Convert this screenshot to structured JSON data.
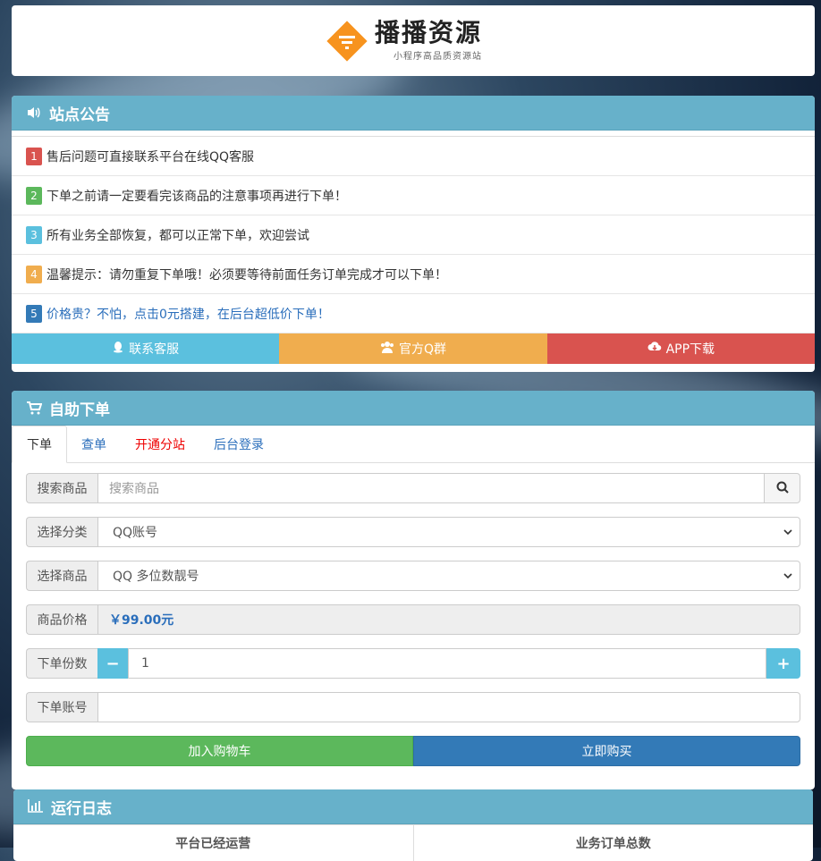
{
  "logo": {
    "title": "播播资源",
    "subtitle": "小程序高品质资源站",
    "accent": "#f7931e"
  },
  "notice": {
    "header": "站点公告",
    "items": [
      {
        "num": "1",
        "text": "售后问题可直接联系平台在线QQ客服"
      },
      {
        "num": "2",
        "text": "下单之前请一定要看完该商品的注意事项再进行下单！"
      },
      {
        "num": "3",
        "text": "所有业务全部恢复，都可以正常下单，欢迎尝试"
      },
      {
        "num": "4",
        "text": "温馨提示：请勿重复下单哦！必须要等待前面任务订单完成才可以下单！"
      },
      {
        "num": "5",
        "text": "价格贵？不怕，点击0元搭建，在后台超低价下单！"
      }
    ],
    "buttons": {
      "contact": "联系客服",
      "qq_group": "官方Q群",
      "app": "APP下载"
    }
  },
  "order": {
    "header": "自助下单",
    "tabs": [
      "下单",
      "查单",
      "开通分站",
      "后台登录"
    ],
    "search": {
      "label": "搜索商品",
      "placeholder": "搜索商品"
    },
    "category": {
      "label": "选择分类",
      "value": "QQ账号"
    },
    "product": {
      "label": "选择商品",
      "value": "QQ 多位数靓号"
    },
    "price": {
      "label": "商品价格",
      "value": "￥99.00元"
    },
    "quantity": {
      "label": "下单份数",
      "value": "1",
      "minus": "−",
      "plus": "+"
    },
    "account": {
      "label": "下单账号",
      "value": ""
    },
    "cart_button": "加入购物车",
    "buy_button": "立即购买"
  },
  "log": {
    "header": "运行日志",
    "col1": "平台已经运营",
    "col2": "业务订单总数"
  },
  "colors": {
    "panel_header": "#67b1ca",
    "info": "#5bc0de",
    "warning": "#f0ad4e",
    "danger": "#d9534f",
    "success": "#5cb85c",
    "primary": "#337ab7"
  }
}
